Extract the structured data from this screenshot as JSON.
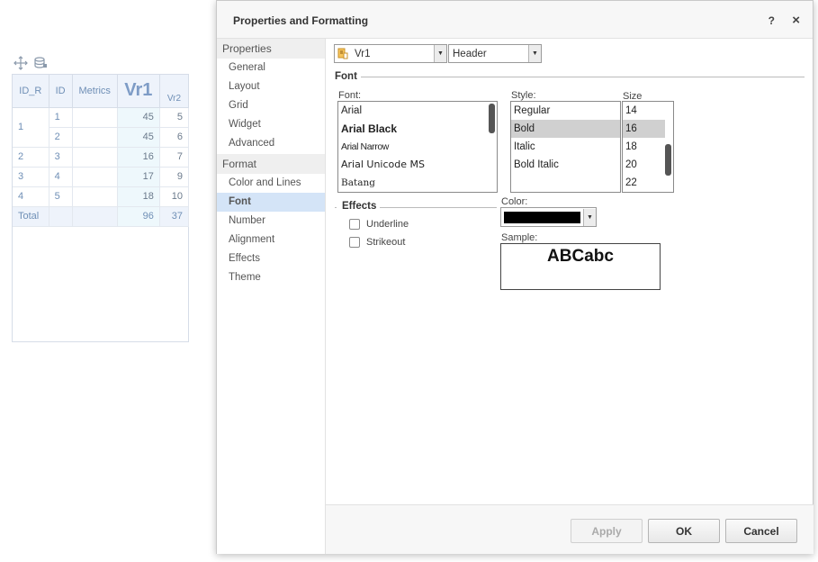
{
  "widget": {
    "headers": [
      "ID_R",
      "ID",
      "Metrics",
      "Vr1",
      "Vr2"
    ],
    "groups": [
      {
        "id_r": "1",
        "rows": [
          {
            "id": "1",
            "vr1": "45",
            "vr2": "5"
          },
          {
            "id": "2",
            "vr1": "45",
            "vr2": "6"
          }
        ]
      },
      {
        "id_r": "2",
        "rows": [
          {
            "id": "3",
            "vr1": "16",
            "vr2": "7"
          }
        ]
      },
      {
        "id_r": "3",
        "rows": [
          {
            "id": "4",
            "vr1": "17",
            "vr2": "9"
          }
        ]
      },
      {
        "id_r": "4",
        "rows": [
          {
            "id": "5",
            "vr1": "18",
            "vr2": "10"
          }
        ]
      }
    ],
    "total": {
      "label": "Total",
      "vr1": "96",
      "vr2": "37"
    },
    "toolbar_icons": [
      "move-icon",
      "datasource-icon"
    ]
  },
  "dialog": {
    "title": "Properties and Formatting",
    "help_label": "?",
    "close_label": "×",
    "sidebar": {
      "properties_label": "Properties",
      "properties_items": [
        "General",
        "Layout",
        "Grid",
        "Widget",
        "Advanced"
      ],
      "format_label": "Format",
      "format_items": [
        "Color and Lines",
        "Font",
        "Number",
        "Alignment",
        "Effects",
        "Theme"
      ],
      "active_item": "Font"
    },
    "element_combo": {
      "value": "Vr1"
    },
    "part_combo": {
      "value": "Header"
    },
    "font_group": {
      "title": "Font",
      "font_label": "Font:",
      "fonts": [
        "Arial",
        "Arial Black",
        "Arial Narrow",
        "Arial Unicode MS",
        "Batang"
      ],
      "style_label": "Style:",
      "styles": [
        "Regular",
        "Bold",
        "Italic",
        "Bold Italic"
      ],
      "selected_style": "Bold",
      "size_label": "Size",
      "sizes": [
        "14",
        "16",
        "18",
        "20",
        "22"
      ],
      "selected_size": "16"
    },
    "effects": {
      "title": "Effects",
      "underline_label": "Underline",
      "strikeout_label": "Strikeout"
    },
    "color": {
      "label": "Color:",
      "value": "#000000"
    },
    "sample": {
      "label": "Sample:",
      "text": "ABCabc"
    },
    "buttons": {
      "apply": "Apply",
      "ok": "OK",
      "cancel": "Cancel"
    }
  }
}
